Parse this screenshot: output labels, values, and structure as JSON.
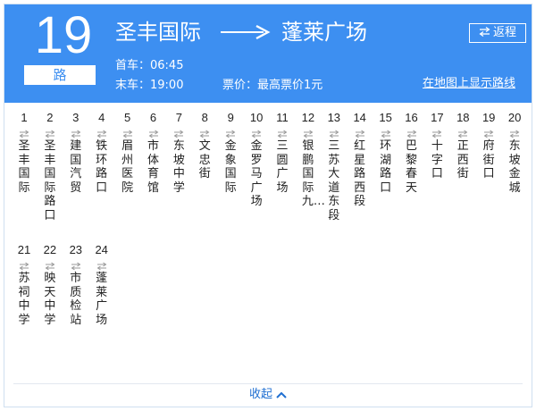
{
  "route": {
    "number": "19",
    "suffix": "路"
  },
  "direction": {
    "from": "圣丰国际",
    "to": "蓬莱广场"
  },
  "schedule": {
    "first": "首车：06:45",
    "last": "末车：19:00"
  },
  "fare": "票价：最高票价1元",
  "actions": {
    "return": "返程",
    "map_link": "在地图上显示路线",
    "collapse": "收起"
  },
  "icons": {
    "direction_arrow": "long-right-arrow",
    "swap": "swap-arrows-icon",
    "collapse": "chevron-up-icon"
  },
  "colors": {
    "header": "#3d8ff1",
    "link": "#1f6fd1"
  },
  "stops": [
    {
      "n": "1",
      "name": "圣丰国际"
    },
    {
      "n": "2",
      "name": "圣丰国际路口"
    },
    {
      "n": "3",
      "name": "建国汽贸"
    },
    {
      "n": "4",
      "name": "铁环路口"
    },
    {
      "n": "5",
      "name": "眉州医院"
    },
    {
      "n": "6",
      "name": "市体育馆"
    },
    {
      "n": "7",
      "name": "东坡中学"
    },
    {
      "n": "8",
      "name": "文忠街"
    },
    {
      "n": "9",
      "name": "金象国际"
    },
    {
      "n": "10",
      "name": "金罗马广场"
    },
    {
      "n": "11",
      "name": "三圆广场"
    },
    {
      "n": "12",
      "name": "银鹏国际九…"
    },
    {
      "n": "13",
      "name": "三苏大道东段"
    },
    {
      "n": "14",
      "name": "红星路西段"
    },
    {
      "n": "15",
      "name": "环湖路口"
    },
    {
      "n": "16",
      "name": "巴黎春天"
    },
    {
      "n": "17",
      "name": "十字口"
    },
    {
      "n": "18",
      "name": "正西街"
    },
    {
      "n": "19",
      "name": "府街口"
    },
    {
      "n": "20",
      "name": "东坡金城"
    },
    {
      "n": "21",
      "name": "苏祠中学"
    },
    {
      "n": "22",
      "name": "映天中学"
    },
    {
      "n": "23",
      "name": "市质检站"
    },
    {
      "n": "24",
      "name": "蓬莱广场"
    }
  ]
}
